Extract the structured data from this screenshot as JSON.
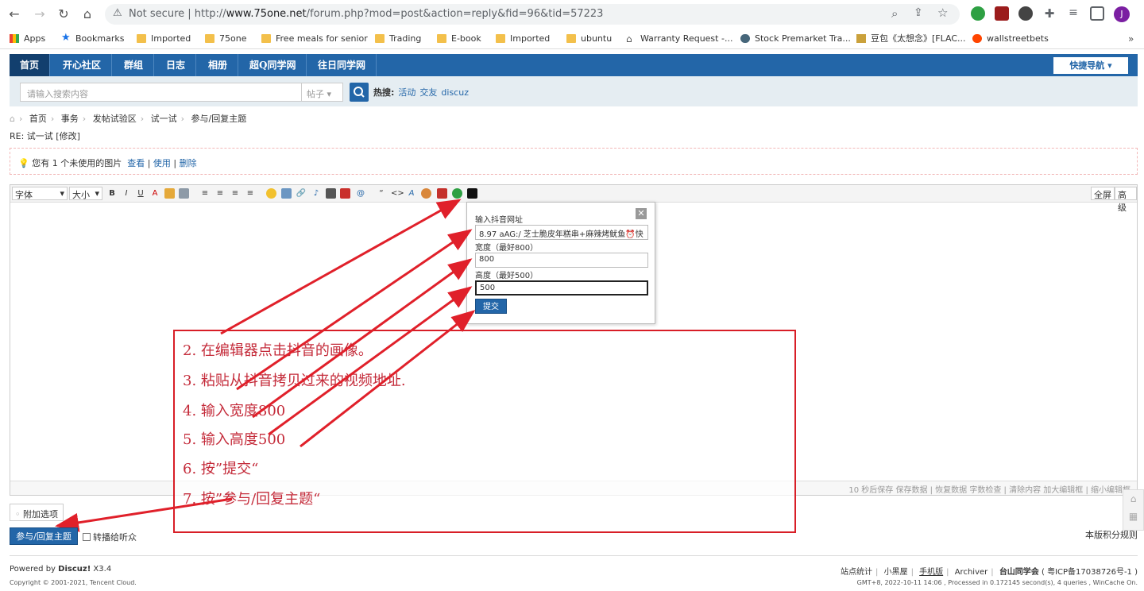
{
  "browser": {
    "not_secure": "Not secure",
    "url_host": "www.75one.net",
    "url_prefix": "http://",
    "url_path": "/forum.php?mod=post&action=reply&fid=96&tid=57223",
    "profile_initial": "J"
  },
  "bookmarks": [
    {
      "label": "Apps",
      "icon": "apps-grid-icon"
    },
    {
      "label": "Bookmarks",
      "icon": "star-icon"
    },
    {
      "label": "Imported",
      "icon": "folder-icon"
    },
    {
      "label": "75one",
      "icon": "folder-icon"
    },
    {
      "label": "Free meals for senior",
      "icon": "folder-icon"
    },
    {
      "label": "Trading",
      "icon": "folder-icon"
    },
    {
      "label": "E-book",
      "icon": "folder-icon"
    },
    {
      "label": "Imported",
      "icon": "folder-icon"
    },
    {
      "label": "ubuntu",
      "icon": "folder-icon"
    },
    {
      "label": "Warranty Request -...",
      "icon": "house-icon"
    },
    {
      "label": "Stock Premarket Tra...",
      "icon": "site-icon"
    },
    {
      "label": "豆包《太想念》[FLAC...",
      "icon": "site-icon"
    },
    {
      "label": "wallstreetbets",
      "icon": "reddit-icon"
    }
  ],
  "topnav": {
    "items": [
      "首页",
      "开心社区",
      "群组",
      "日志",
      "相册",
      "超Q同学网",
      "往日同学网"
    ],
    "quick": "快捷导航"
  },
  "search": {
    "placeholder": "请输入搜索内容",
    "type": "帖子",
    "hot_label": "热搜:",
    "hot_items": [
      "活动",
      "交友",
      "discuz"
    ]
  },
  "breadcrumb": [
    "首页",
    "事务",
    "发帖试验区",
    "试一试",
    "参与/回复主题"
  ],
  "reply_title": "RE: 试一试 [修改]",
  "notice": {
    "text": "您有 1 个未使用的图片",
    "view": "查看",
    "use": "使用",
    "delete": "删除"
  },
  "editor": {
    "font_select": "字体",
    "size_select": "大小",
    "fullscreen": "全屏",
    "advanced": "高级",
    "status": "10 秒后保存 保存数据 | 恢复数据    字数检查 | 清除内容    加大编辑框 | 缩小编辑框"
  },
  "popup": {
    "url_label": "输入抖音网址",
    "url_value": "8.97 aAG:/ 芝士脆皮年糕串+麻辣烤鱿鱼⏰快",
    "width_label": "宽度（最好800）",
    "width_value": "800",
    "height_label": "高度（最好500）",
    "height_value": "500",
    "submit": "提交"
  },
  "annotation_steps": [
    "2.  在编辑器点击抖音的画像。",
    "3.  粘贴从抖音拷贝过来的视频地址.",
    "4.  输入宽度800",
    "5.  输入高度500",
    "6.  按”提交“",
    "7.  按”参与/回复主题“"
  ],
  "bottom": {
    "attach": "附加选项",
    "reply_button": "参与/回复主题",
    "broadcast": "转播给听众",
    "rules": "本版积分规则"
  },
  "footer": {
    "powered_prefix": "Powered by ",
    "powered_brand": "Discuz!",
    "powered_version": " X3.4",
    "copyright": "Copyright © 2001-2021, Tencent Cloud.",
    "links": [
      "站点统计",
      "小黑屋",
      "手机版",
      "Archiver",
      "台山同学会",
      "( 粤ICP备17038726号-1 )"
    ],
    "gmt": "GMT+8, 2022-10-11 14:06 , Processed in 0.172145 second(s), 4 queries , WinCache On."
  },
  "colors": {
    "nav_blue": "#2366a8",
    "nav_active": "#123f6e",
    "annotation_red": "#d81e27",
    "search_bg": "#e5edf2"
  }
}
